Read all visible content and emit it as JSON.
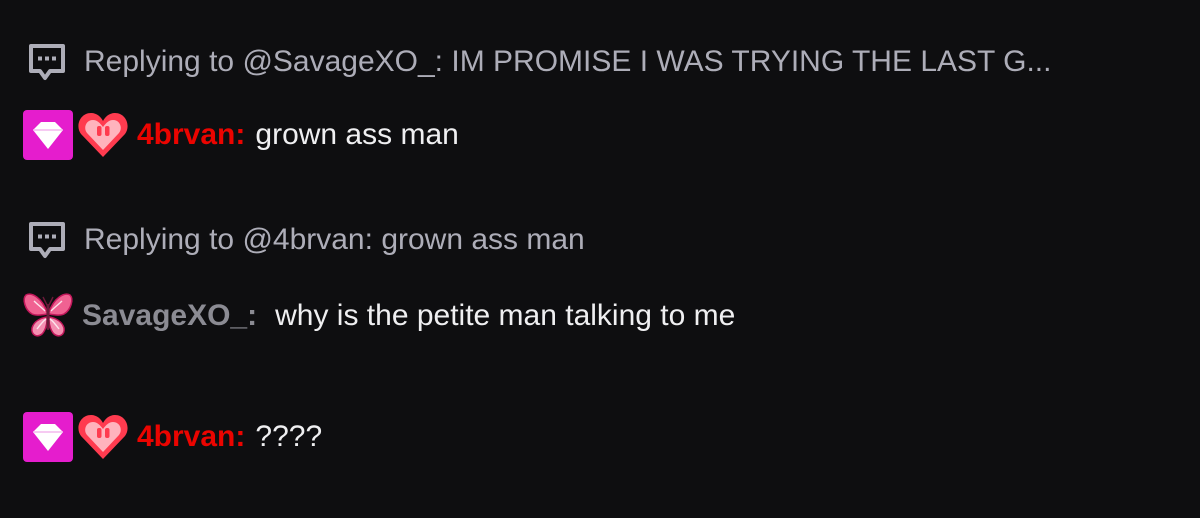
{
  "colors": {
    "background": "#0e0e10",
    "reply_text": "#adadb8",
    "message_text": "#efeff1",
    "user_4brvan": "#eb0400",
    "user_savagexo": "#8b8b93",
    "diamond_badge": "#e51dcd",
    "heart_badge": "#ff3b4f"
  },
  "messages": [
    {
      "reply": {
        "icon": "reply-icon",
        "prefix": "Replying to",
        "target": "@SavageXO_:",
        "text": "IM PROMISE I WAS TRYING THE LAST G..."
      },
      "badges": [
        "diamond-badge-icon",
        "heart-badge-icon"
      ],
      "username": "4brvan",
      "colon": ":",
      "text": "grown ass man"
    },
    {
      "reply": {
        "icon": "reply-icon",
        "prefix": "Replying to",
        "target": "@4brvan:",
        "text": "grown ass man"
      },
      "badges": [
        "butterfly-badge-icon"
      ],
      "username": "SavageXO_",
      "colon": ":",
      "text": "why is the petite man talking to me"
    },
    {
      "badges": [
        "diamond-badge-icon",
        "heart-badge-icon"
      ],
      "username": "4brvan",
      "colon": ":",
      "text": "????"
    }
  ]
}
